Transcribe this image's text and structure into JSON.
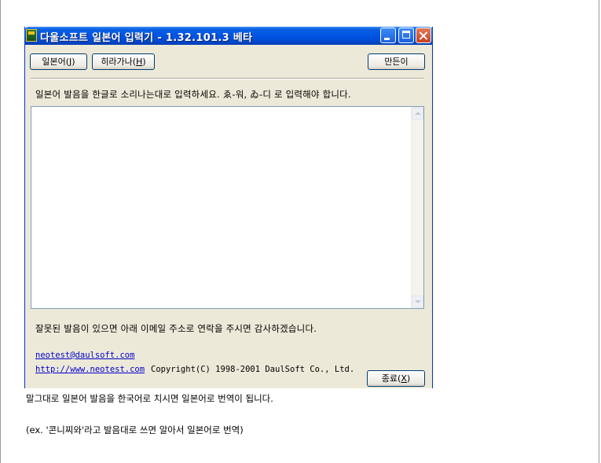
{
  "window": {
    "title": "다울소프트 일본어 입력기 - 1.32.101.3 베타"
  },
  "toolbar": {
    "japanese_label": "일본어(",
    "japanese_key": "J",
    "hiragana_label": "히라가나(",
    "hiragana_key": "H",
    "key_close": ")",
    "maker_label": "만든이"
  },
  "instruction_text": "일본어 발음을 한글로 소리나는대로 입력하세요.  ゑ-워, ゐ-디 로 입력해야 합니다.",
  "input": {
    "value": ""
  },
  "error_note": "잘못된 발음이 있으면 아래 이메일 주소로 연락을 주시면 감사하겠습니다.",
  "footer": {
    "email": "neotest@daulsoft.com",
    "url": "http://www.neotest.com",
    "copyright": "Copyright(C) 1998-2001 DaulSoft Co., Ltd.",
    "exit_label": "종료(",
    "exit_key": "X"
  },
  "page_text": {
    "caption_1": "말그대로 일본어 발음을 한국어로 치시면 일본어로 번역이 됩니다.",
    "caption_2": "(ex. '콘니찌와'라고 발음대로 쓰면 알아서 일본어로 번역)"
  },
  "colors": {
    "titlebar": "#0054e3",
    "window_face": "#ece9d8",
    "link": "#0000cc"
  }
}
